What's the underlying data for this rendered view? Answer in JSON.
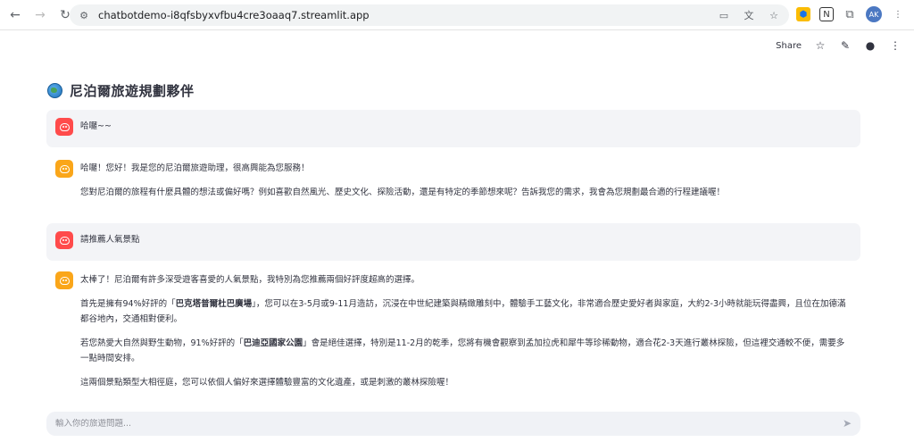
{
  "browser": {
    "url": "chatbotdemo-i8qfsbyxvfbu4cre3oaaq7.streamlit.app",
    "profile_initials": "AK"
  },
  "toolbar": {
    "share_label": "Share"
  },
  "page": {
    "title": "尼泊爾旅遊規劃夥伴"
  },
  "messages": [
    {
      "role": "user",
      "text": "哈囉~~"
    },
    {
      "role": "assistant",
      "paragraphs": [
        "哈囉！您好！我是您的尼泊爾旅遊助理，很高興能為您服務！",
        "您對尼泊爾的旅程有什麼具體的想法或偏好嗎？例如喜歡自然風光、歷史文化、探險活動，還是有特定的季節想來呢？告訴我您的需求，我會為您規劃最合適的行程建議喔！"
      ]
    },
    {
      "role": "user",
      "text": "請推薦人氣景點"
    },
    {
      "role": "assistant",
      "p1": "太棒了！尼泊爾有許多深受遊客喜愛的人氣景點，我特別為您推薦兩個好評度超高的選擇。",
      "p2_pre": "首先是擁有94%好評的「",
      "p2_bold": "巴克塔普爾杜巴廣場",
      "p2_post": "」，您可以在3-5月或9-11月造訪，沉浸在中世紀建築與精緻雕刻中，體驗手工藝文化，非常適合歷史愛好者與家庭，大約2-3小時就能玩得盡興，且位在加德滿都谷地內，交通相對便利。",
      "p3_pre": "若您熱愛大自然與野生動物，91%好評的「",
      "p3_bold": "巴迪亞國家公園",
      "p3_post": "」會是絕佳選擇，特別是11-2月的乾季，您將有機會觀察到孟加拉虎和犀牛等珍稀動物，適合花2-3天進行叢林探險，但這裡交通較不便，需要多一點時間安排。",
      "p4": "這兩個景點類型大相徑庭，您可以依個人偏好來選擇體驗豐富的文化遺產，或是刺激的叢林探險喔！"
    }
  ],
  "chat_input": {
    "placeholder": "輸入你的旅遊問題..."
  },
  "colors": {
    "user_avatar": "#ff4b4b",
    "assistant_avatar": "#faa61a",
    "user_bubble": "#f3f4f7"
  }
}
